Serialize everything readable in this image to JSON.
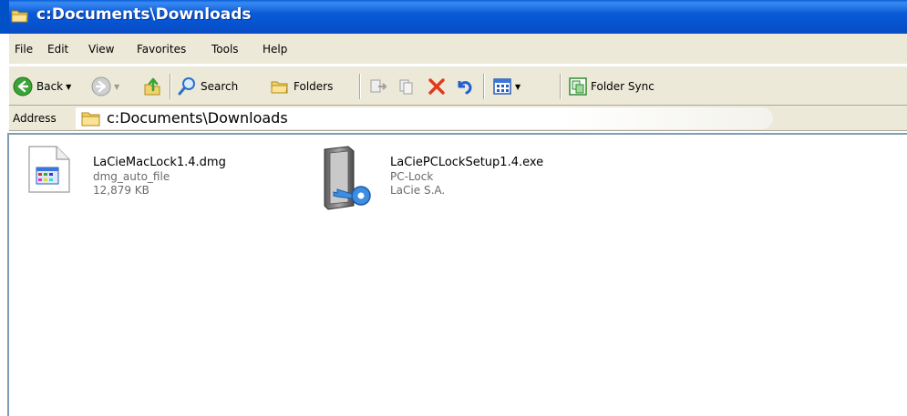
{
  "window": {
    "title": "c:Documents\\Downloads"
  },
  "menu": {
    "items": [
      {
        "label": "File"
      },
      {
        "label": "Edit"
      },
      {
        "label": "View"
      },
      {
        "label": "Favorites"
      },
      {
        "label": "Tools"
      },
      {
        "label": "Help"
      }
    ]
  },
  "toolbar": {
    "back_label": "Back",
    "search_label": "Search",
    "folders_label": "Folders",
    "folder_sync_label": "Folder Sync"
  },
  "address": {
    "label": "Address",
    "value": "c:Documents\\Downloads"
  },
  "files": [
    {
      "name": "LaCieMacLock1.4.dmg",
      "type": "dmg_auto_file",
      "detail": "12,879 KB",
      "icon": "generic-file-icon"
    },
    {
      "name": "LaCiePCLockSetup1.4.exe",
      "type": "PC-Lock",
      "detail": "LaCie S.A.",
      "icon": "installer-key-icon"
    }
  ],
  "colors": {
    "titlebar": "#0a5bd6",
    "chrome": "#ece9d8",
    "delete_x": "#e03a1a"
  }
}
